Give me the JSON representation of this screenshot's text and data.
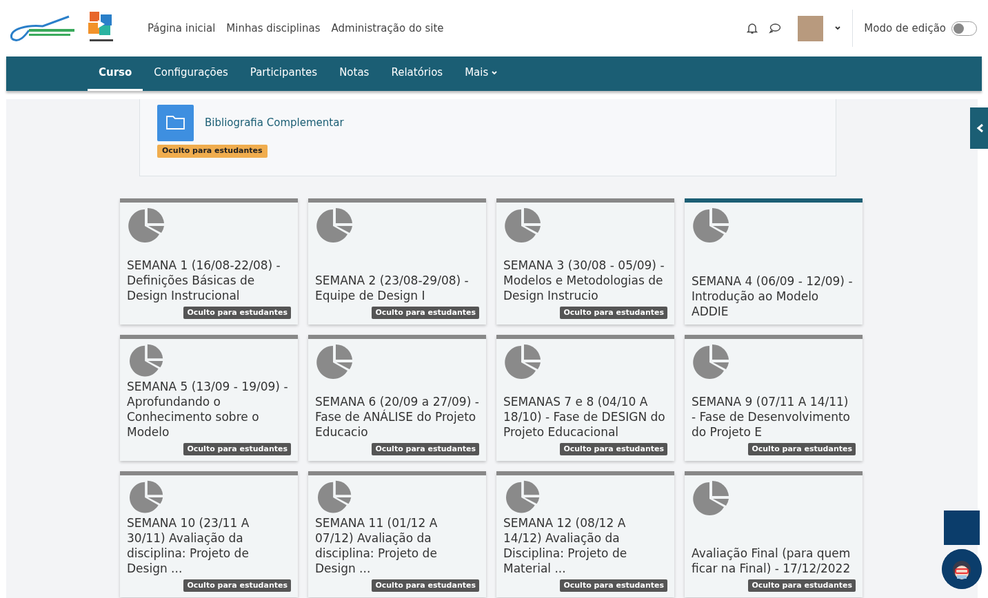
{
  "header": {
    "nav_links": [
      "Página inicial",
      "Minhas disciplinas",
      "Administração do site"
    ],
    "edit_mode": {
      "label": "Modo de edição",
      "on": false
    }
  },
  "course_nav": {
    "tabs": [
      {
        "label": "Curso",
        "selected": true
      },
      {
        "label": "Configurações",
        "selected": false
      },
      {
        "label": "Participantes",
        "selected": false
      },
      {
        "label": "Notas",
        "selected": false
      },
      {
        "label": "Relatórios",
        "selected": false
      },
      {
        "label": "Mais",
        "selected": false,
        "kind": "dropdown"
      }
    ]
  },
  "resource": {
    "name": "Bibliografia Complementar",
    "badge": "Oculto para estudantes"
  },
  "cards": [
    {
      "title": "SEMANA 1 (16/08-22/08) - Definições Básicas de Design Instrucional",
      "current": false,
      "badge": "Oculto para estudantes"
    },
    {
      "title": "SEMANA 2 (23/08-29/08) - Equipe de Design I",
      "current": false,
      "badge": "Oculto para estudantes"
    },
    {
      "title": "SEMANA 3 (30/08 - 05/09) - Modelos e Metodologias de Design Instrucio",
      "current": false,
      "badge": "Oculto para estudantes"
    },
    {
      "title": "SEMANA 4 (06/09 - 12/09) - Introdução ao Modelo ADDIE",
      "current": true
    },
    {
      "title": "SEMANA 5 (13/09 - 19/09) - Aprofundando o Conhecimento sobre o Modelo",
      "current": false,
      "badge": "Oculto para estudantes"
    },
    {
      "title": "SEMANA 6 (20/09 a 27/09) - Fase de ANÁLISE do Projeto Educacio",
      "current": false,
      "badge": "Oculto para estudantes"
    },
    {
      "title": "SEMANAS 7 e 8 (04/10 A 18/10) - Fase de DESIGN do Projeto Educacional",
      "current": false,
      "badge": "Oculto para estudantes"
    },
    {
      "title": "SEMANA 9 (07/11 A 14/11) - Fase de Desenvolvimento do Projeto E",
      "current": false,
      "badge": "Oculto para estudantes"
    },
    {
      "title": "SEMANA 10 (23/11 A 30/11) Avaliação da disciplina: Projeto de Design ...",
      "current": false,
      "badge": "Oculto para estudantes"
    },
    {
      "title": "SEMANA 11 (01/12 A 07/12) Avaliação da disciplina: Projeto de Design ...",
      "current": false,
      "badge": "Oculto para estudantes"
    },
    {
      "title": "SEMANA 12 (08/12 A 14/12) Avaliação da Disciplina: Projeto de Material ...",
      "current": false,
      "badge": "Oculto para estudantes"
    },
    {
      "title": "Avaliação Final (para quem ficar na Final) - 17/12/2022",
      "current": false,
      "badge": "Oculto para estudantes"
    }
  ]
}
